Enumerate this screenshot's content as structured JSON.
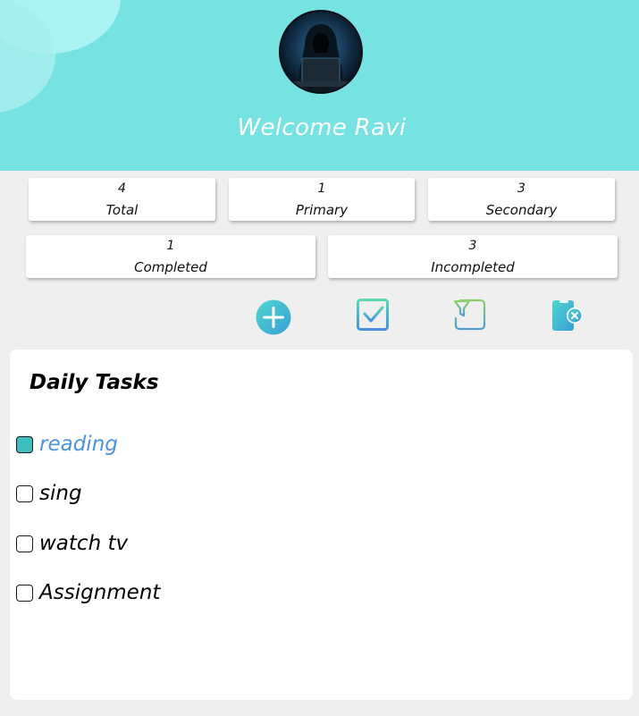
{
  "header": {
    "welcome": "Welcome Ravi"
  },
  "stats": {
    "total": {
      "value": "4",
      "label": "Total"
    },
    "primary": {
      "value": "1",
      "label": "Primary"
    },
    "secondary": {
      "value": "3",
      "label": "Secondary"
    },
    "completed": {
      "value": "1",
      "label": "Completed"
    },
    "incompleted": {
      "value": "3",
      "label": "Incompleted"
    }
  },
  "toolbar": {
    "icons": [
      "add-icon",
      "check-icon",
      "filter-icon",
      "clear-icon"
    ]
  },
  "tasks": {
    "title": "Daily Tasks",
    "items": [
      {
        "label": "reading",
        "checked": true
      },
      {
        "label": "sing",
        "checked": false
      },
      {
        "label": "watch tv",
        "checked": false
      },
      {
        "label": "Assignment",
        "checked": false
      }
    ]
  },
  "colors": {
    "header_bg": "#77e2e2",
    "accent": "#3ebfbf",
    "done_text": "#4a93e0"
  }
}
